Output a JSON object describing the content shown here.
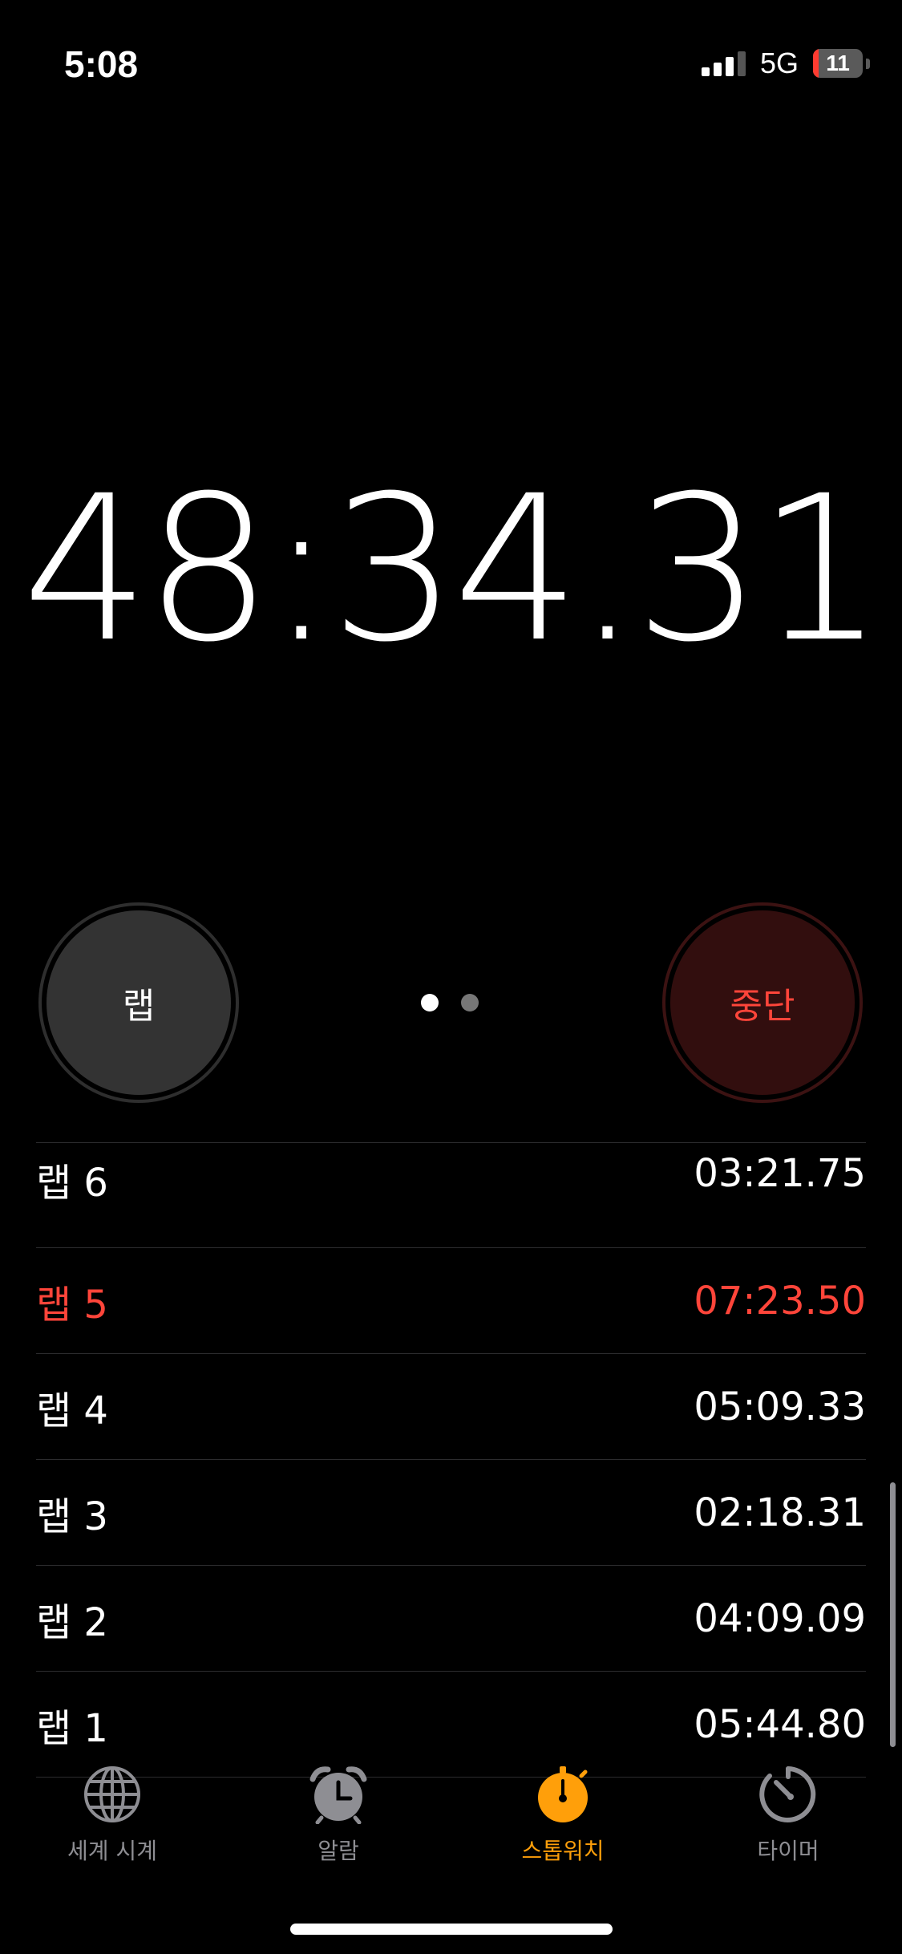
{
  "status_bar": {
    "time": "5:08",
    "network": "5G",
    "battery_percent": 11,
    "battery_label": "11"
  },
  "stopwatch": {
    "elapsed": "48:34.31"
  },
  "controls": {
    "lap_label": "랩",
    "stop_label": "중단",
    "page_count": 2,
    "active_page": 1
  },
  "laps": [
    {
      "label": "랩 6",
      "time": "03:21.75",
      "highlight": "none"
    },
    {
      "label": "랩 5",
      "time": "07:23.50",
      "highlight": "slowest"
    },
    {
      "label": "랩 4",
      "time": "05:09.33",
      "highlight": "none"
    },
    {
      "label": "랩 3",
      "time": "02:18.31",
      "highlight": "none"
    },
    {
      "label": "랩 2",
      "time": "04:09.09",
      "highlight": "none"
    },
    {
      "label": "랩 1",
      "time": "05:44.80",
      "highlight": "none"
    }
  ],
  "tabs": [
    {
      "label": "세계 시계",
      "icon": "globe-icon",
      "active": false
    },
    {
      "label": "알람",
      "icon": "alarm-clock-icon",
      "active": false
    },
    {
      "label": "스톱워치",
      "icon": "stopwatch-icon",
      "active": true
    },
    {
      "label": "타이머",
      "icon": "timer-icon",
      "active": false
    }
  ],
  "colors": {
    "background": "#000000",
    "accent": "#ff9f0a",
    "stop_red": "#ff453a",
    "inactive_gray": "#8e8e93"
  }
}
